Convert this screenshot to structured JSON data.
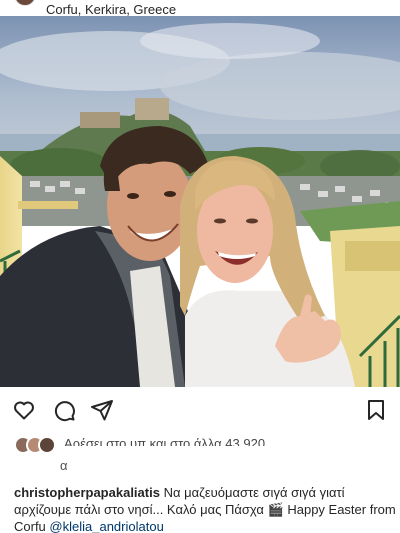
{
  "post": {
    "location": "Corfu, Kerkira, Greece",
    "username": "christopherpapakaliatis",
    "caption_greek": "Να μαζευόμαστε σιγά σιγά γιατί αρχίζουμε πάλι στο νησί... Καλό μας Πάσχα",
    "caption_english": "Happy Easter from Corfu",
    "mention": "@klelia_andriolatou",
    "emoji": "🎬",
    "likes_text": "Αρέσει στο υπ και στο άλλα 43.920",
    "likes_line2": "α"
  },
  "actions": {
    "like_icon": "heart-icon",
    "comment_icon": "comment-icon",
    "share_icon": "share-icon",
    "save_icon": "bookmark-icon"
  },
  "colors": {
    "mention": "#00376b",
    "text": "#262626"
  }
}
